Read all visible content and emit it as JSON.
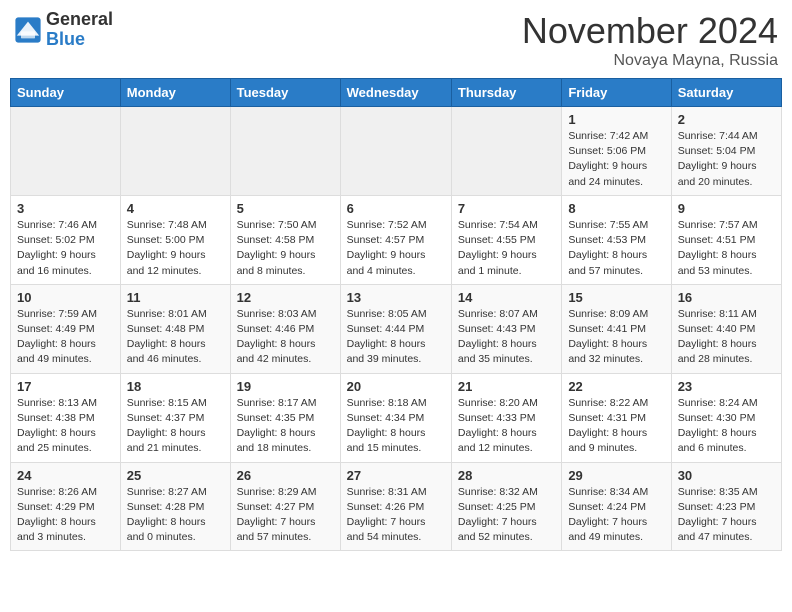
{
  "logo": {
    "general": "General",
    "blue": "Blue"
  },
  "header": {
    "month": "November 2024",
    "location": "Novaya Mayna, Russia"
  },
  "days": [
    "Sunday",
    "Monday",
    "Tuesday",
    "Wednesday",
    "Thursday",
    "Friday",
    "Saturday"
  ],
  "weeks": [
    [
      {
        "day": "",
        "info": ""
      },
      {
        "day": "",
        "info": ""
      },
      {
        "day": "",
        "info": ""
      },
      {
        "day": "",
        "info": ""
      },
      {
        "day": "",
        "info": ""
      },
      {
        "day": "1",
        "info": "Sunrise: 7:42 AM\nSunset: 5:06 PM\nDaylight: 9 hours and 24 minutes."
      },
      {
        "day": "2",
        "info": "Sunrise: 7:44 AM\nSunset: 5:04 PM\nDaylight: 9 hours and 20 minutes."
      }
    ],
    [
      {
        "day": "3",
        "info": "Sunrise: 7:46 AM\nSunset: 5:02 PM\nDaylight: 9 hours and 16 minutes."
      },
      {
        "day": "4",
        "info": "Sunrise: 7:48 AM\nSunset: 5:00 PM\nDaylight: 9 hours and 12 minutes."
      },
      {
        "day": "5",
        "info": "Sunrise: 7:50 AM\nSunset: 4:58 PM\nDaylight: 9 hours and 8 minutes."
      },
      {
        "day": "6",
        "info": "Sunrise: 7:52 AM\nSunset: 4:57 PM\nDaylight: 9 hours and 4 minutes."
      },
      {
        "day": "7",
        "info": "Sunrise: 7:54 AM\nSunset: 4:55 PM\nDaylight: 9 hours and 1 minute."
      },
      {
        "day": "8",
        "info": "Sunrise: 7:55 AM\nSunset: 4:53 PM\nDaylight: 8 hours and 57 minutes."
      },
      {
        "day": "9",
        "info": "Sunrise: 7:57 AM\nSunset: 4:51 PM\nDaylight: 8 hours and 53 minutes."
      }
    ],
    [
      {
        "day": "10",
        "info": "Sunrise: 7:59 AM\nSunset: 4:49 PM\nDaylight: 8 hours and 49 minutes."
      },
      {
        "day": "11",
        "info": "Sunrise: 8:01 AM\nSunset: 4:48 PM\nDaylight: 8 hours and 46 minutes."
      },
      {
        "day": "12",
        "info": "Sunrise: 8:03 AM\nSunset: 4:46 PM\nDaylight: 8 hours and 42 minutes."
      },
      {
        "day": "13",
        "info": "Sunrise: 8:05 AM\nSunset: 4:44 PM\nDaylight: 8 hours and 39 minutes."
      },
      {
        "day": "14",
        "info": "Sunrise: 8:07 AM\nSunset: 4:43 PM\nDaylight: 8 hours and 35 minutes."
      },
      {
        "day": "15",
        "info": "Sunrise: 8:09 AM\nSunset: 4:41 PM\nDaylight: 8 hours and 32 minutes."
      },
      {
        "day": "16",
        "info": "Sunrise: 8:11 AM\nSunset: 4:40 PM\nDaylight: 8 hours and 28 minutes."
      }
    ],
    [
      {
        "day": "17",
        "info": "Sunrise: 8:13 AM\nSunset: 4:38 PM\nDaylight: 8 hours and 25 minutes."
      },
      {
        "day": "18",
        "info": "Sunrise: 8:15 AM\nSunset: 4:37 PM\nDaylight: 8 hours and 21 minutes."
      },
      {
        "day": "19",
        "info": "Sunrise: 8:17 AM\nSunset: 4:35 PM\nDaylight: 8 hours and 18 minutes."
      },
      {
        "day": "20",
        "info": "Sunrise: 8:18 AM\nSunset: 4:34 PM\nDaylight: 8 hours and 15 minutes."
      },
      {
        "day": "21",
        "info": "Sunrise: 8:20 AM\nSunset: 4:33 PM\nDaylight: 8 hours and 12 minutes."
      },
      {
        "day": "22",
        "info": "Sunrise: 8:22 AM\nSunset: 4:31 PM\nDaylight: 8 hours and 9 minutes."
      },
      {
        "day": "23",
        "info": "Sunrise: 8:24 AM\nSunset: 4:30 PM\nDaylight: 8 hours and 6 minutes."
      }
    ],
    [
      {
        "day": "24",
        "info": "Sunrise: 8:26 AM\nSunset: 4:29 PM\nDaylight: 8 hours and 3 minutes."
      },
      {
        "day": "25",
        "info": "Sunrise: 8:27 AM\nSunset: 4:28 PM\nDaylight: 8 hours and 0 minutes."
      },
      {
        "day": "26",
        "info": "Sunrise: 8:29 AM\nSunset: 4:27 PM\nDaylight: 7 hours and 57 minutes."
      },
      {
        "day": "27",
        "info": "Sunrise: 8:31 AM\nSunset: 4:26 PM\nDaylight: 7 hours and 54 minutes."
      },
      {
        "day": "28",
        "info": "Sunrise: 8:32 AM\nSunset: 4:25 PM\nDaylight: 7 hours and 52 minutes."
      },
      {
        "day": "29",
        "info": "Sunrise: 8:34 AM\nSunset: 4:24 PM\nDaylight: 7 hours and 49 minutes."
      },
      {
        "day": "30",
        "info": "Sunrise: 8:35 AM\nSunset: 4:23 PM\nDaylight: 7 hours and 47 minutes."
      }
    ]
  ]
}
